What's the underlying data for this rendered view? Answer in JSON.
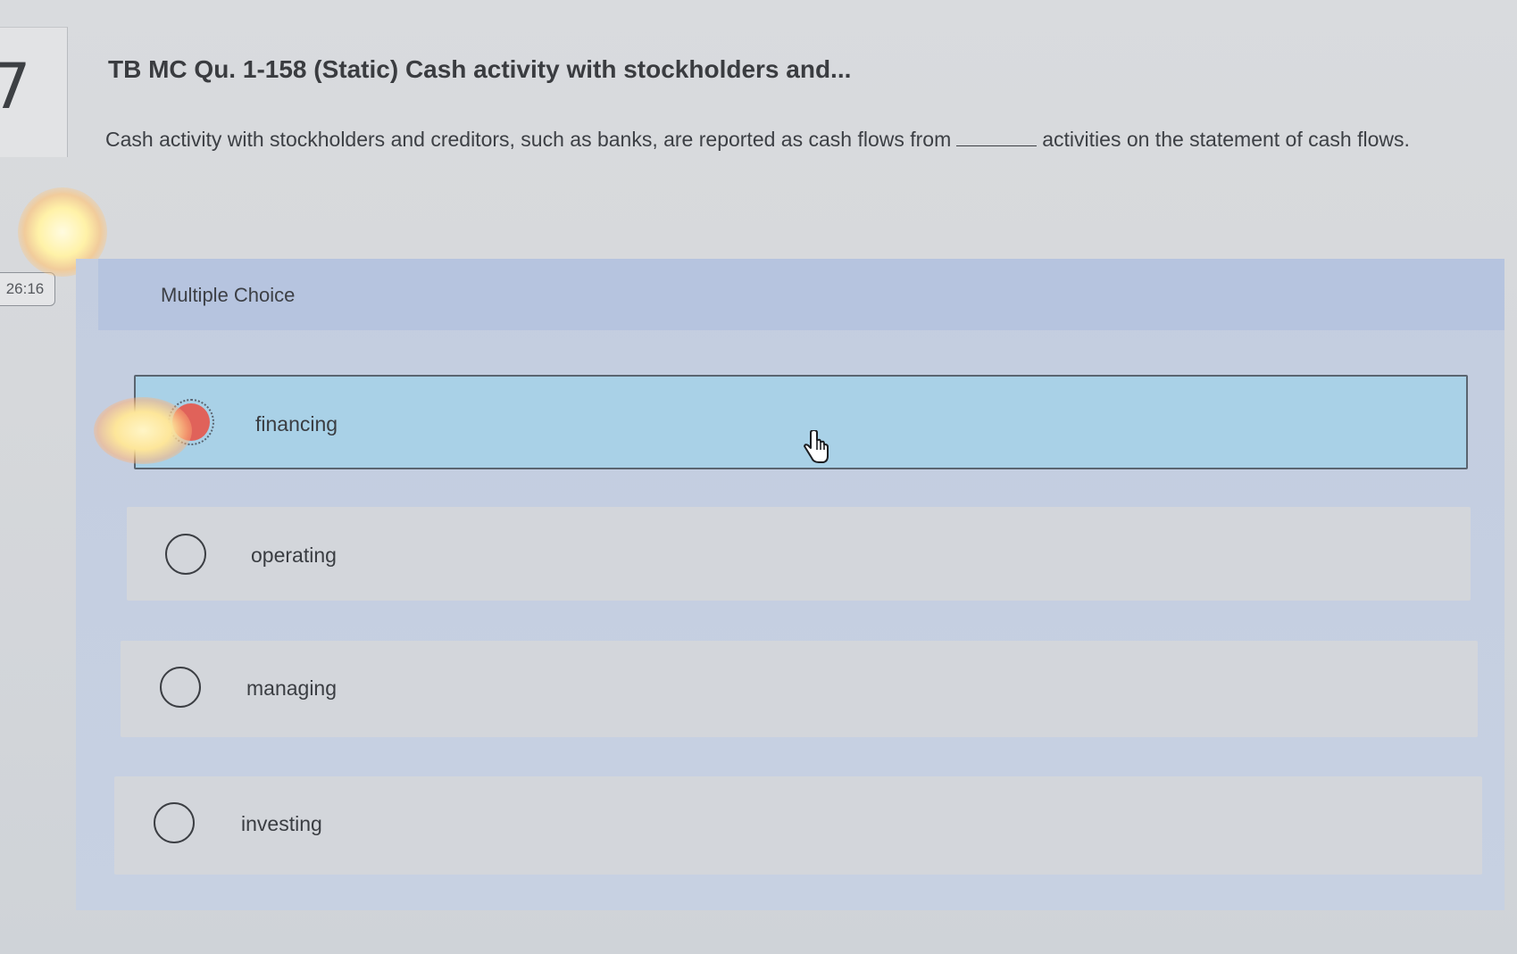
{
  "question_number": "7",
  "timer": "26:16",
  "title": "TB MC Qu. 1-158 (Static) Cash activity with stockholders and...",
  "question": {
    "text_before": "Cash activity with stockholders and creditors, such as banks, are reported as cash flows from",
    "text_after": "activities on the statement of cash flows."
  },
  "multiple_choice": {
    "label": "Multiple Choice",
    "options": [
      {
        "label": "financing",
        "selected": true
      },
      {
        "label": "operating",
        "selected": false
      },
      {
        "label": "managing",
        "selected": false
      },
      {
        "label": "investing",
        "selected": false
      }
    ]
  },
  "colors": {
    "selected_option_bg": "#a9d1e7",
    "selected_radio": "#e0625a",
    "panel_bg": "#c3cde0"
  },
  "icons": {
    "cursor": "hand-pointer-icon"
  }
}
